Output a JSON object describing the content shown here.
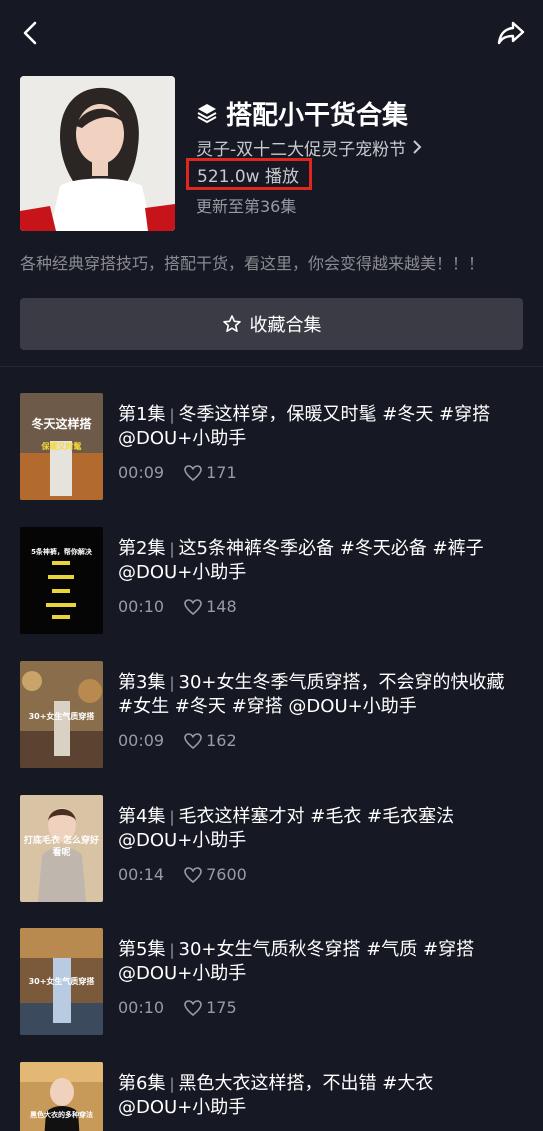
{
  "nav": {
    "back_icon": "chevron-left-icon",
    "share_icon": "share-arrow-icon"
  },
  "header": {
    "title_icon": "layers-icon",
    "title": "搭配小干货合集",
    "author": "灵子-双十二大促灵子宠粉节",
    "plays": "521.0w 播放",
    "updated": "更新至第36集",
    "description": "各种经典穿搭技巧，搭配干货，看这里，你会变得越来越美！！！",
    "highlight_color": "#e0271d"
  },
  "collect_button": {
    "icon": "star-outline-icon",
    "label": "收藏合集"
  },
  "episodes": [
    {
      "num": "第1集",
      "title": "冬季这样穿，保暖又时髦 #冬天  #穿搭 @DOU+小助手",
      "duration": "00:09",
      "likes": "171",
      "thumb_text": "冬天这样搭",
      "thumb_sub": "保暖又时髦"
    },
    {
      "num": "第2集",
      "title": "这5条神裤冬季必备 #冬天必备 #裤子 @DOU+小助手",
      "duration": "00:10",
      "likes": "148",
      "thumb_text": "5条神裤，帮你解决"
    },
    {
      "num": "第3集",
      "title": "30+女生冬季气质穿搭，不会穿的快收藏 #女生  #冬天  #穿搭 @DOU+小助手",
      "duration": "00:09",
      "likes": "162",
      "thumb_text": "30+女生气质穿搭"
    },
    {
      "num": "第4集",
      "title": "毛衣这样塞才对 #毛衣  #毛衣塞法 @DOU+小助手",
      "duration": "00:14",
      "likes": "7600",
      "thumb_text": "打底毛衣 怎么穿好看呢"
    },
    {
      "num": "第5集",
      "title": "30+女生气质秋冬穿搭 #气质  #穿搭 @DOU+小助手",
      "duration": "00:10",
      "likes": "175",
      "thumb_text": "30+女生气质穿搭"
    },
    {
      "num": "第6集",
      "title": "黑色大衣这样搭，不出错 #大衣 @DOU+小助手",
      "duration": "",
      "likes": "",
      "thumb_text": "黑色大衣的多种穿法"
    }
  ]
}
